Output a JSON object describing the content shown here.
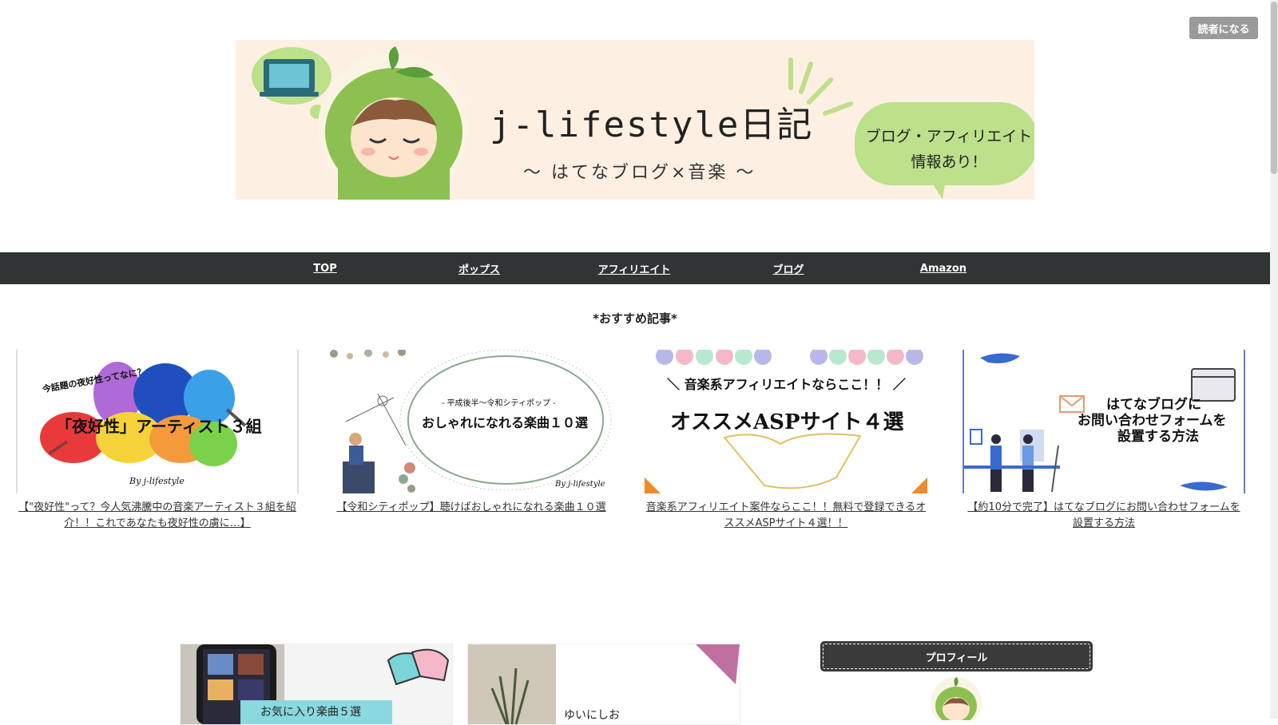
{
  "top": {
    "subscribe_label": "読者になる"
  },
  "banner": {
    "title": "j-lifestyle日記",
    "subtitle": "～ はてなブログ×音楽 ～",
    "bubble_line1": "ブログ・アフィリエイト",
    "bubble_line2": "情報あり！"
  },
  "nav": [
    {
      "label": "TOP"
    },
    {
      "label": "ポップス"
    },
    {
      "label": "アフィリエイト"
    },
    {
      "label": "ブログ"
    },
    {
      "label": "Amazon"
    }
  ],
  "recommended": {
    "heading": "*おすすめ記事*",
    "cards": [
      {
        "thumb_small": "今話題の夜好性ってなに？",
        "thumb_main": "「夜好性」アーティスト３組",
        "thumb_sign": "By j-lifestyle",
        "title": "【\"夜好性\"って？今人気沸騰中の音楽アーティスト３組を紹介！！これであなたも夜好性の虜に…】"
      },
      {
        "thumb_small": "- 平成後半～令和シティポップ -",
        "thumb_main": "おしゃれになれる楽曲１０選",
        "thumb_sign": "By j-lifestyle",
        "title": "【令和シティポップ】聴けばおしゃれになれる楽曲１０選"
      },
      {
        "thumb_small": "＼ 音楽系アフィリエイトならここ！！ ／",
        "thumb_main": "オススメASPサイト４選",
        "title": "音楽系アフィリエイト案件ならここ！！無料で登録できるオススメASPサイト４選！！"
      },
      {
        "thumb_line1": "はてなブログに",
        "thumb_line2": "お問い合わせフォームを",
        "thumb_line3": "設置する方法",
        "title": "【約10分で完了】はてなブログにお問い合わせフォームを設置する方法"
      }
    ]
  },
  "bottom": {
    "card1_caption": "お気に入り楽曲５選",
    "card2_caption": "ゆいにしお",
    "profile_heading": "プロフィール"
  },
  "colors": {
    "navbar": "#313435",
    "banner_bg": "#fdf0e2",
    "mascot_green": "#8cc152",
    "subscribe_bg": "#9a9a9a"
  }
}
